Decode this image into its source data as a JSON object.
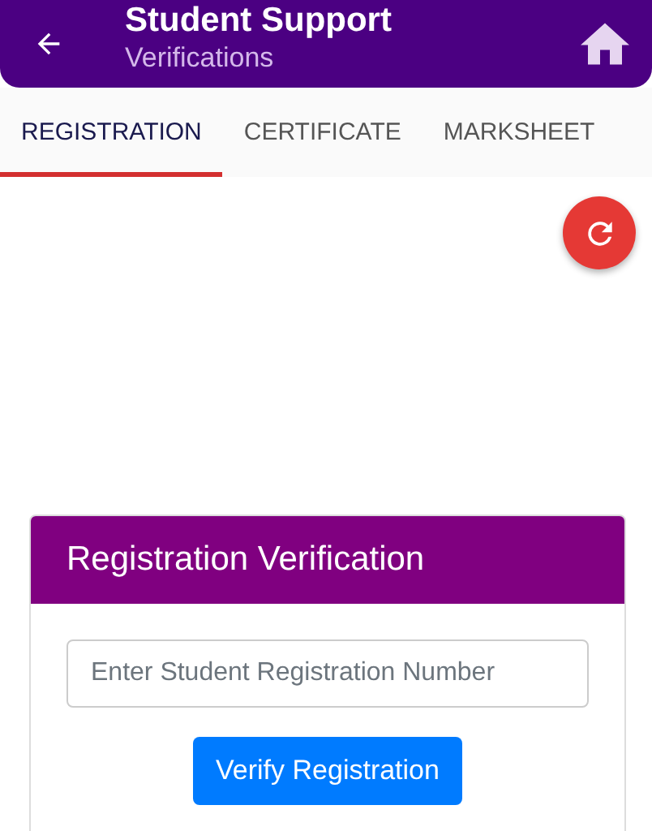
{
  "app_bar": {
    "title": "Student Support",
    "subtitle": "Verifications"
  },
  "tabs": [
    {
      "label": "REGISTRATION",
      "selected": true
    },
    {
      "label": "CERTIFICATE",
      "selected": false
    },
    {
      "label": "MARKSHEET",
      "selected": false
    }
  ],
  "card": {
    "title": "Registration Verification",
    "field": {
      "placeholder": "Enter Student Registration Number"
    },
    "button": "Verify Registration"
  }
}
